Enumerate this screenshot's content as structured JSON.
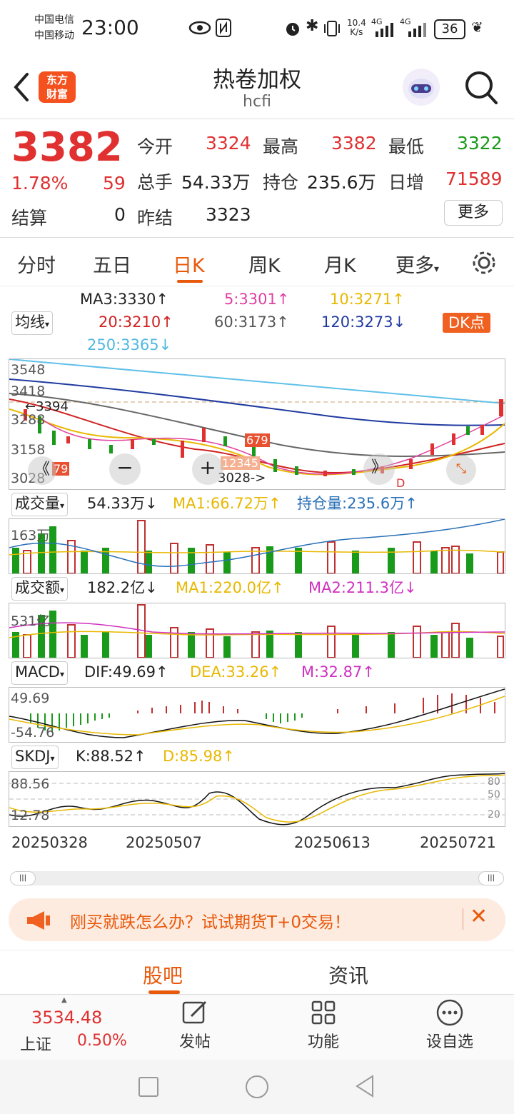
{
  "status_bar": {
    "carrier1": "中国电信",
    "carrier2": "中国移动",
    "time": "23:00",
    "net_speed_top": "10.4",
    "net_speed_unit": "K/s",
    "sig1": "4G",
    "sig2": "4G",
    "battery": "36"
  },
  "header": {
    "logo_line1": "东方",
    "logo_line2": "财富",
    "title": "热卷加权",
    "subtitle": "hcfi"
  },
  "quote": {
    "price": "3382",
    "change_pct": "1.78%",
    "change": "59",
    "open_label": "今开",
    "open": "3324",
    "high_label": "最高",
    "high": "3382",
    "low_label": "最低",
    "low": "3322",
    "volume_label": "总手",
    "volume": "54.33万",
    "oi_label": "持仓",
    "oi": "235.6万",
    "oi_change_label": "日增",
    "oi_change": "71589",
    "settle_label": "结算",
    "settle": "0",
    "prev_settle_label": "昨结",
    "prev_settle": "3323",
    "more_button": "更多"
  },
  "period_tabs": [
    "分时",
    "五日",
    "日K",
    "周K",
    "月K",
    "更多"
  ],
  "ma": {
    "selector": "均线",
    "ma3": "MA3:3330↑",
    "ma5": "5:3301↑",
    "ma10": "10:3271↑",
    "ma20": "20:3210↑",
    "ma60": "60:3173↑",
    "ma120": "120:3273↓",
    "ma250": "250:3365↓",
    "dk_button": "DK点"
  },
  "kline": {
    "y_labels": [
      "3548",
      "3418",
      "3288",
      "3158",
      "3028"
    ],
    "annot_high": "3394",
    "annot_low": "3028->",
    "nine_left": "79",
    "nine_mid": "12345",
    "nine_right": "679",
    "d_marker": "D",
    "prev_button": "《",
    "zoom_out": "−",
    "zoom_in": "+",
    "next_button": "》"
  },
  "volume_panel": {
    "selector": "成交量",
    "value": "54.33万↓",
    "ma1": "MA1:66.72万↑",
    "oi": "持仓量:235.6万↑",
    "y_label": "163万"
  },
  "amount_panel": {
    "selector": "成交额",
    "value": "182.2亿↓",
    "ma1": "MA1:220.0亿↑",
    "ma2": "MA2:211.3亿↓",
    "y_label": "531亿"
  },
  "macd_panel": {
    "selector": "MACD",
    "dif": "DIF:49.69↑",
    "dea": "DEA:33.26↑",
    "m": "M:32.87↑",
    "y_top": "49.69",
    "y_bottom": "-54.76"
  },
  "skdj_panel": {
    "selector": "SKDJ",
    "k": "K:88.52↑",
    "d": "D:85.98↑",
    "y_top": "88.56",
    "y_bottom": "12.78",
    "levels": [
      "80",
      "50",
      "20"
    ]
  },
  "dates": [
    "20250328",
    "20250507",
    "20250613",
    "20250721"
  ],
  "promo": {
    "text": "刚买就跌怎么办？试试期货T+0交易！"
  },
  "bottom_tabs": [
    "股吧",
    "资讯"
  ],
  "bottom_nav": {
    "index_value": "3534.48",
    "index_name": "上证",
    "index_change": "0.50%",
    "post": "发帖",
    "functions": "功能",
    "watchlist": "设自选"
  },
  "colors": {
    "up": "#e03030",
    "down": "#1a9a1a",
    "accent": "#e9590c"
  }
}
